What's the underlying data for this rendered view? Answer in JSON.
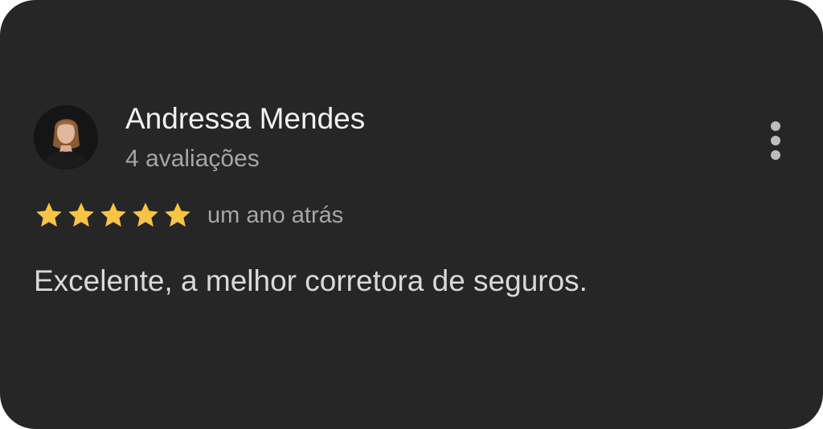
{
  "review": {
    "reviewer_name": "Andressa Mendes",
    "review_count": "4 avaliações",
    "rating": 5,
    "rating_max": 5,
    "date": "um ano atrás",
    "text": "Excelente, a melhor corretora de seguros."
  },
  "icons": {
    "menu": "more-vert-icon",
    "star": "star-icon"
  },
  "colors": {
    "card_background": "#262626",
    "star": "#f7c543",
    "primary_text": "#f2f2f2",
    "secondary_text": "#a6a6a6"
  }
}
